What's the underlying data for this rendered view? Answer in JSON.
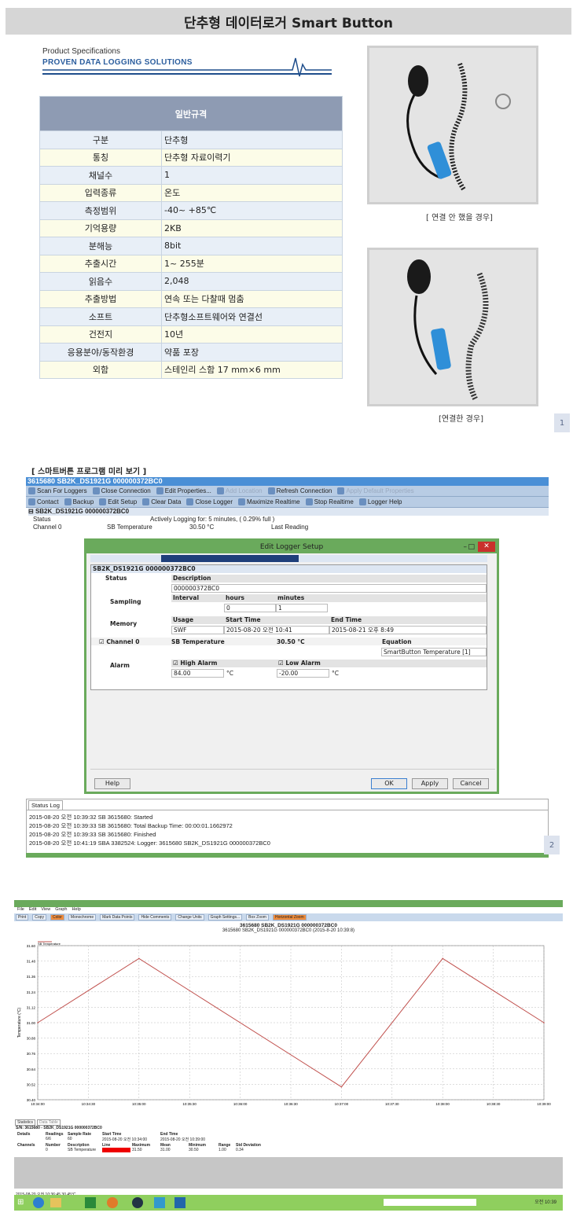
{
  "page_title": "단추형 데이터로거 Smart Button",
  "brand": {
    "line1": "Product Specifications",
    "line2": "PROVEN DATA LOGGING SOLUTIONS"
  },
  "spec_table": {
    "header": "일반규격",
    "rows": [
      {
        "k": "구분",
        "v": "단추형"
      },
      {
        "k": "통칭",
        "v": "단추형 자료이력기"
      },
      {
        "k": "채널수",
        "v": "1"
      },
      {
        "k": "입력종류",
        "v": "온도"
      },
      {
        "k": "측정범위",
        "v": "-40~ +85℃"
      },
      {
        "k": "기억용량",
        "v": "2KB"
      },
      {
        "k": "분해능",
        "v": "8bit"
      },
      {
        "k": "추출시간",
        "v": "1~ 255분"
      },
      {
        "k": "읽음수",
        "v": "2,048"
      },
      {
        "k": "추출방법",
        "v": "연속 또는 다찰때 멈춤"
      },
      {
        "k": "소프트",
        "v": "단추형소프트웨어와 연결선"
      },
      {
        "k": "건전지",
        "v": "10년"
      },
      {
        "k": "응용분야/동작환경",
        "v": "약품 포장"
      },
      {
        "k": "외함",
        "v": "스테인리 스함 17 mm×6 mm"
      }
    ]
  },
  "photo1_caption": "[ 연결 안 했을 경우]",
  "photo2_caption": "[연결한 경우]",
  "page1_num": "1",
  "page2_num": "2",
  "section2_title": "[ 스마트버튼 프로그램 미리 보기 ]",
  "app": {
    "title": "3615680 SB2K_DS1921G 000000372BC0",
    "toolbar1": [
      "Scan For Loggers",
      "Close Connection",
      "Edit Properties...",
      "Add Location",
      "Refresh Connection",
      "Apply Default Properties"
    ],
    "toolbar2": [
      "Contact",
      "Backup",
      "Edit Setup",
      "Clear Data",
      "Close Logger",
      "Maximize Realtime",
      "Stop Realtime",
      "Logger Help"
    ],
    "tree_root": "SB2K_DS1921G 000000372BC0",
    "tree_status": "Status",
    "tree_status_val": "Actively Logging for: 5 minutes, ( 0.29% full )",
    "tree_channel": "Channel 0",
    "tree_channel_desc": "SB Temperature",
    "tree_channel_temp": "30.50 °C",
    "tree_last": "Last Reading"
  },
  "dialog": {
    "title": "Edit Logger Setup",
    "root": "SB2K_DS1921G 000000372BC0",
    "status": "Status",
    "description": "Description",
    "desc_val": "000000372BC0",
    "sampling": "Sampling",
    "interval": "Interval",
    "hours": "hours",
    "minutes": "minutes",
    "hours_val": "0",
    "minutes_val": "1",
    "memory": "Memory",
    "usage": "Usage",
    "start_time": "Start Time",
    "end_time": "End Time",
    "usage_val": "SWF",
    "start_val": "2015-08-20 오전 10:41",
    "end_val": "2015-08-21 오후 8:49",
    "channel0": "Channel 0",
    "sb_temp": "SB Temperature",
    "temp_val": "30.50 °C",
    "equation": "Equation",
    "equation_val": "SmartButton Temperature [1]",
    "alarm": "Alarm",
    "high_alarm": "High Alarm",
    "low_alarm": "Low Alarm",
    "high_val": "84.00",
    "low_val": "-20.00",
    "unit": "°C",
    "help": "Help",
    "ok": "OK",
    "apply": "Apply",
    "cancel": "Cancel"
  },
  "status_log": {
    "tab": "Status Log",
    "lines": [
      "2015-08-20 오전 10:39:32  SB 3615680: Started",
      "2015-08-20 오전 10:39:33  SB 3615680: Total Backup Time: 00:00:01.1662972",
      "2015-08-20 오전 10:39:33  SB 3615680: Finished",
      "2015-08-20 오전 10:41:19  SBA 3382524: Logger: 3615680 SB2K_DS1921G 000000372BC0"
    ]
  },
  "graph_app": {
    "menu": [
      "File",
      "Edit",
      "View",
      "Graph",
      "Help"
    ],
    "toolbar": [
      "Print",
      "Copy",
      "Color",
      "Monochrome",
      "Mark Data Points",
      "Hide Comments",
      "Change Units",
      "Graph Settings...",
      "Box Zoom",
      "Horizontal Zoom"
    ],
    "title": "3615680 SB2K_DS1921G 000000372BC0",
    "subtitle": "3615680 SB2K_DS1921G 000000372BC0 (2015-8-20 10:39:8)",
    "statusbar": "2015-08-20 오전 10:36:45  30.45°C"
  },
  "chart_data": {
    "type": "line",
    "title": "3615680 SB2K_DS1921G 000000372BC0",
    "ylabel": "Temperature (°C)",
    "legend": [
      "SB Temperature"
    ],
    "ylim": [
      30.4,
      31.6
    ],
    "yticks": [
      "31.60",
      "31.48",
      "31.36",
      "31.24",
      "31.12",
      "31.00",
      "30.88",
      "30.76",
      "30.64",
      "30.52",
      "30.40"
    ],
    "xticks": [
      "10:34:00",
      "10:34:30",
      "10:35:00",
      "10:35:30",
      "10:36:00",
      "10:36:30",
      "10:37:00",
      "10:37:30",
      "10:38:00",
      "10:38:30",
      "10:39:00"
    ],
    "x": [
      "10:34:00",
      "10:35:00",
      "10:37:00",
      "10:38:00",
      "10:39:00"
    ],
    "series": [
      {
        "name": "SB Temperature",
        "values": [
          31.0,
          31.5,
          30.5,
          31.5,
          31.0
        ],
        "color": "#c0504d"
      }
    ]
  },
  "stats": {
    "tabs": [
      "Statistics",
      "Data Table"
    ],
    "sn": "S/N: 3615680 - SB2K_DS1921G 000000372BC0",
    "details_hdr": [
      "Details",
      "Readings",
      "Sample Rate",
      "Start Time",
      "End Time"
    ],
    "details_val": [
      "6/6",
      "60",
      "2015-08-20 오전 10:34:00",
      "2015-08-20 오전 10:39:00"
    ],
    "ch_hdr": [
      "Channels",
      "Number",
      "Description",
      "Line",
      "Maximum",
      "Mean",
      "Minimum",
      "Range",
      "Std Deviation"
    ],
    "ch_val": [
      "0",
      "SB Temperature",
      "31.50",
      "31.00",
      "30.50",
      "1.00",
      "0.34"
    ]
  },
  "taskbar_clock": "오전 10:39"
}
